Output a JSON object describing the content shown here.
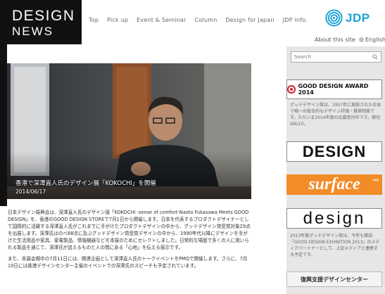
{
  "brand": {
    "logo_line1": "DESIGN",
    "logo_line2": "NEWS"
  },
  "nav": {
    "items": [
      "Top",
      "Pick up",
      "Event & Seminar",
      "Column",
      "Design for Japan",
      "JDP info."
    ]
  },
  "jdp_logo": {
    "text": "JDP",
    "color": "#1aa3d8"
  },
  "header_links": {
    "about": "About this site",
    "language": "English"
  },
  "search": {
    "placeholder": "Search"
  },
  "sidebar": {
    "gda_banner_label": "GOOD DESIGN AWARD 2014",
    "gda_description": "グッドデザイン賞は、1957年に創設された日本で唯一の総合的なデザイン評価・推奨制度です。ただいま2014年度の応募受付中です。締切は6/10。",
    "design_banner_label": "DESIGN",
    "surface_banner_label": "surface",
    "surface_tag": "asia",
    "design2_banner_label": "design",
    "design2_description": "2013年度グッドデザイン賞は、今年も雑誌「GOOD DESIGN EXHIBITION 2013」のメディアパートナーとして、上記メディアと連携する予定です。",
    "fukko_banner_label": "復興支援デザインセンター"
  },
  "hero": {
    "title": "香港で深澤直人氏のデザイン展「KOKOCHI」を開催",
    "date": "2014/06/17"
  },
  "article": {
    "paragraph1": "日本デザイン振興会は、深澤直人氏のデザイン展「KOKOCHI -sense of comfort-Naoto Fukasawa Meets GOOD DESIGN」を、香港のGOOD DESIGN STOREで7月1日から開催します。日本を代表するプロダクトデザイナーとして国際的に活躍する深澤直人氏がこれまでに手がけたプロダクトデザインの中から、グッドデザイン賞受賞対象29点を出展します。深澤氏はのべ88点に及ぶグッドデザイン賞受賞デザインの中から、1990年代以降にデザインを手がけた生活用品や家具、家電製品、情報機器などを本展のためにセレクトしました。日常的な場面で多くの人に用いられる製品を通じて、深澤氏が追えるものと人の間にある「心地」を伝える展示です。",
    "paragraph2": "また、本展会期中の7月11日には、関連企画として深澤直人氏のトークイベントをPMQで開催します。さらに、7月10日には香港デザインセンター主催のイベントでの深澤氏のスピーチも予定されています。"
  }
}
